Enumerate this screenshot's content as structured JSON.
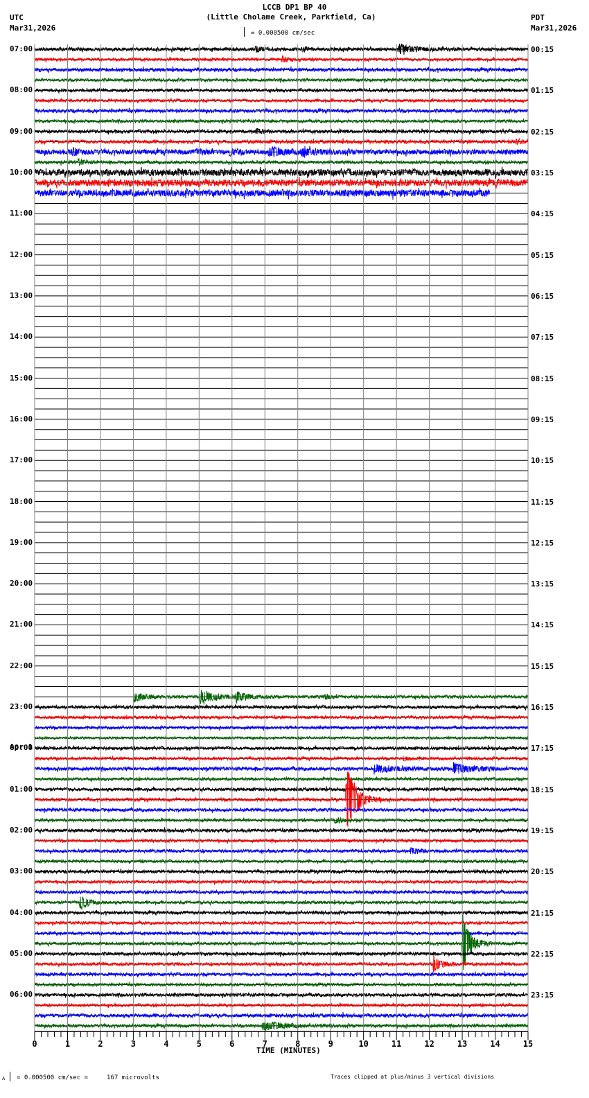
{
  "header": {
    "title": "LCCB DP1 BP 40",
    "subtitle": "(Little Cholame Creek, Parkfield, Ca)",
    "left_tz": "UTC",
    "left_date": "Mar31,2026",
    "right_tz": "PDT",
    "right_date": "Mar31,2026",
    "scale": "= 0.000500 cm/sec"
  },
  "footer": {
    "scale_note": "= 0.000500 cm/sec =     167 microvolts",
    "clip_note": "Traces clipped at plus/minus 3 vertical divisions",
    "corner_mark": "A"
  },
  "left_labels": [
    "07:00",
    "08:00",
    "09:00",
    "10:00",
    "11:00",
    "12:00",
    "13:00",
    "14:00",
    "15:00",
    "16:00",
    "17:00",
    "18:00",
    "19:00",
    "20:00",
    "21:00",
    "22:00",
    "23:00",
    "00:00",
    "01:00",
    "02:00",
    "03:00",
    "04:00",
    "05:00",
    "06:00"
  ],
  "date_change_label": "Apr 1",
  "right_labels": [
    "00:15",
    "01:15",
    "02:15",
    "03:15",
    "04:15",
    "05:15",
    "06:15",
    "07:15",
    "08:15",
    "09:15",
    "10:15",
    "11:15",
    "12:15",
    "13:15",
    "14:15",
    "15:15",
    "16:15",
    "17:15",
    "18:15",
    "19:15",
    "20:15",
    "21:15",
    "22:15",
    "23:15"
  ],
  "chart_data": {
    "type": "line",
    "subtype": "helicorder",
    "xlabel": "TIME (MINUTES)",
    "xlim": [
      0,
      15
    ],
    "x_ticks": [
      "0",
      "1",
      "2",
      "3",
      "4",
      "5",
      "6",
      "7",
      "8",
      "9",
      "10",
      "11",
      "12",
      "13",
      "14",
      "15"
    ],
    "rows_per_hour": 4,
    "row_count": 96,
    "clip_divisions": 3,
    "colors": [
      "#000000",
      "#ff0000",
      "#0000ff",
      "#006400"
    ],
    "grid_color": "#808080",
    "traces": [
      {
        "row": 0,
        "start": 0,
        "end": 15,
        "noise": 0.14,
        "events": [
          [
            6.7,
            0.3,
            0.15
          ],
          [
            8.1,
            0.22,
            0.15
          ],
          [
            11.05,
            0.5,
            0.4
          ]
        ]
      },
      {
        "row": 1,
        "start": 0,
        "end": 15,
        "noise": 0.12,
        "events": [
          [
            7.5,
            0.3,
            0.15
          ]
        ]
      },
      {
        "row": 2,
        "start": 0,
        "end": 15,
        "noise": 0.14,
        "events": []
      },
      {
        "row": 3,
        "start": 0,
        "end": 15,
        "noise": 0.12,
        "events": []
      },
      {
        "row": 4,
        "start": 0,
        "end": 15,
        "noise": 0.13,
        "events": []
      },
      {
        "row": 5,
        "start": 0,
        "end": 15,
        "noise": 0.12,
        "events": []
      },
      {
        "row": 6,
        "start": 0,
        "end": 15,
        "noise": 0.14,
        "events": []
      },
      {
        "row": 7,
        "start": 0,
        "end": 15,
        "noise": 0.12,
        "events": []
      },
      {
        "row": 8,
        "start": 0,
        "end": 15,
        "noise": 0.14,
        "events": [
          [
            6.7,
            0.3,
            0.15
          ]
        ]
      },
      {
        "row": 9,
        "start": 0,
        "end": 15,
        "noise": 0.14,
        "events": [
          [
            14.6,
            0.25,
            0.2
          ]
        ]
      },
      {
        "row": 10,
        "start": 0,
        "end": 15,
        "noise": 0.2,
        "events": [
          [
            1.1,
            0.35,
            0.2
          ],
          [
            4.9,
            0.3,
            0.2
          ],
          [
            5.9,
            0.3,
            0.2
          ],
          [
            7.1,
            0.45,
            0.35
          ],
          [
            8.1,
            0.5,
            0.3
          ]
        ]
      },
      {
        "row": 11,
        "start": 0,
        "end": 15,
        "noise": 0.13,
        "events": [
          [
            1.3,
            0.3,
            0.15
          ]
        ]
      },
      {
        "row": 12,
        "start": 0,
        "end": 15,
        "noise": 0.27,
        "events": []
      },
      {
        "row": 13,
        "start": 0,
        "end": 15,
        "noise": 0.27,
        "events": []
      },
      {
        "row": 14,
        "start": 0,
        "end": 13.85,
        "noise": 0.27,
        "events": []
      },
      {
        "row": 63,
        "start": 3.0,
        "end": 15,
        "noise": 0.13,
        "events": [
          [
            3.0,
            0.45,
            0.3
          ],
          [
            5.0,
            0.7,
            0.4
          ],
          [
            6.1,
            0.5,
            0.3
          ],
          [
            8.8,
            0.2,
            0.2
          ]
        ]
      },
      {
        "row": 64,
        "start": 0,
        "end": 15,
        "noise": 0.13,
        "events": []
      },
      {
        "row": 65,
        "start": 0,
        "end": 15,
        "noise": 0.12,
        "events": []
      },
      {
        "row": 66,
        "start": 0,
        "end": 15,
        "noise": 0.12,
        "events": []
      },
      {
        "row": 67,
        "start": 0,
        "end": 15,
        "noise": 0.1,
        "events": []
      },
      {
        "row": 68,
        "start": 0,
        "end": 15,
        "noise": 0.13,
        "events": []
      },
      {
        "row": 69,
        "start": 0,
        "end": 15,
        "noise": 0.12,
        "events": [
          [
            11.2,
            0.2,
            0.15
          ]
        ]
      },
      {
        "row": 70,
        "start": 0,
        "end": 15,
        "noise": 0.14,
        "events": [
          [
            10.3,
            0.35,
            0.6
          ],
          [
            12.7,
            0.55,
            0.5
          ]
        ]
      },
      {
        "row": 71,
        "start": 0,
        "end": 15,
        "noise": 0.12,
        "events": []
      },
      {
        "row": 72,
        "start": 0,
        "end": 15,
        "noise": 0.13,
        "events": []
      },
      {
        "row": 73,
        "start": 0,
        "end": 15,
        "noise": 0.13,
        "events": [
          [
            9.45,
            4.5,
            0.25
          ]
        ]
      },
      {
        "row": 74,
        "start": 0,
        "end": 15,
        "noise": 0.13,
        "events": []
      },
      {
        "row": 75,
        "start": 0,
        "end": 15,
        "noise": 0.12,
        "events": [
          [
            9.1,
            0.3,
            0.2
          ]
        ]
      },
      {
        "row": 76,
        "start": 0,
        "end": 15,
        "noise": 0.13,
        "events": []
      },
      {
        "row": 77,
        "start": 0,
        "end": 15,
        "noise": 0.12,
        "events": []
      },
      {
        "row": 78,
        "start": 0,
        "end": 15,
        "noise": 0.13,
        "events": [
          [
            11.4,
            0.3,
            0.25
          ]
        ]
      },
      {
        "row": 79,
        "start": 0,
        "end": 15,
        "noise": 0.12,
        "events": []
      },
      {
        "row": 80,
        "start": 0,
        "end": 15,
        "noise": 0.13,
        "events": []
      },
      {
        "row": 81,
        "start": 0,
        "end": 15,
        "noise": 0.12,
        "events": []
      },
      {
        "row": 82,
        "start": 0,
        "end": 15,
        "noise": 0.13,
        "events": []
      },
      {
        "row": 83,
        "start": 0,
        "end": 15,
        "noise": 0.12,
        "events": [
          [
            1.35,
            1.0,
            0.2
          ]
        ]
      },
      {
        "row": 84,
        "start": 0,
        "end": 15,
        "noise": 0.13,
        "events": []
      },
      {
        "row": 85,
        "start": 0,
        "end": 15,
        "noise": 0.12,
        "events": []
      },
      {
        "row": 86,
        "start": 0,
        "end": 15,
        "noise": 0.13,
        "events": []
      },
      {
        "row": 87,
        "start": 0,
        "end": 15,
        "noise": 0.12,
        "events": [
          [
            12.98,
            3.5,
            0.2
          ]
        ]
      },
      {
        "row": 88,
        "start": 0,
        "end": 15,
        "noise": 0.13,
        "events": []
      },
      {
        "row": 89,
        "start": 0,
        "end": 15,
        "noise": 0.13,
        "events": [
          [
            12.1,
            1.0,
            0.2
          ]
        ]
      },
      {
        "row": 90,
        "start": 0,
        "end": 15,
        "noise": 0.13,
        "events": []
      },
      {
        "row": 91,
        "start": 0,
        "end": 15,
        "noise": 0.12,
        "events": []
      },
      {
        "row": 92,
        "start": 0,
        "end": 15,
        "noise": 0.13,
        "events": []
      },
      {
        "row": 93,
        "start": 0,
        "end": 15,
        "noise": 0.12,
        "events": []
      },
      {
        "row": 94,
        "start": 0,
        "end": 15,
        "noise": 0.14,
        "events": []
      },
      {
        "row": 95,
        "start": 0,
        "end": 15,
        "noise": 0.13,
        "events": [
          [
            6.9,
            0.4,
            0.6
          ]
        ]
      }
    ]
  }
}
